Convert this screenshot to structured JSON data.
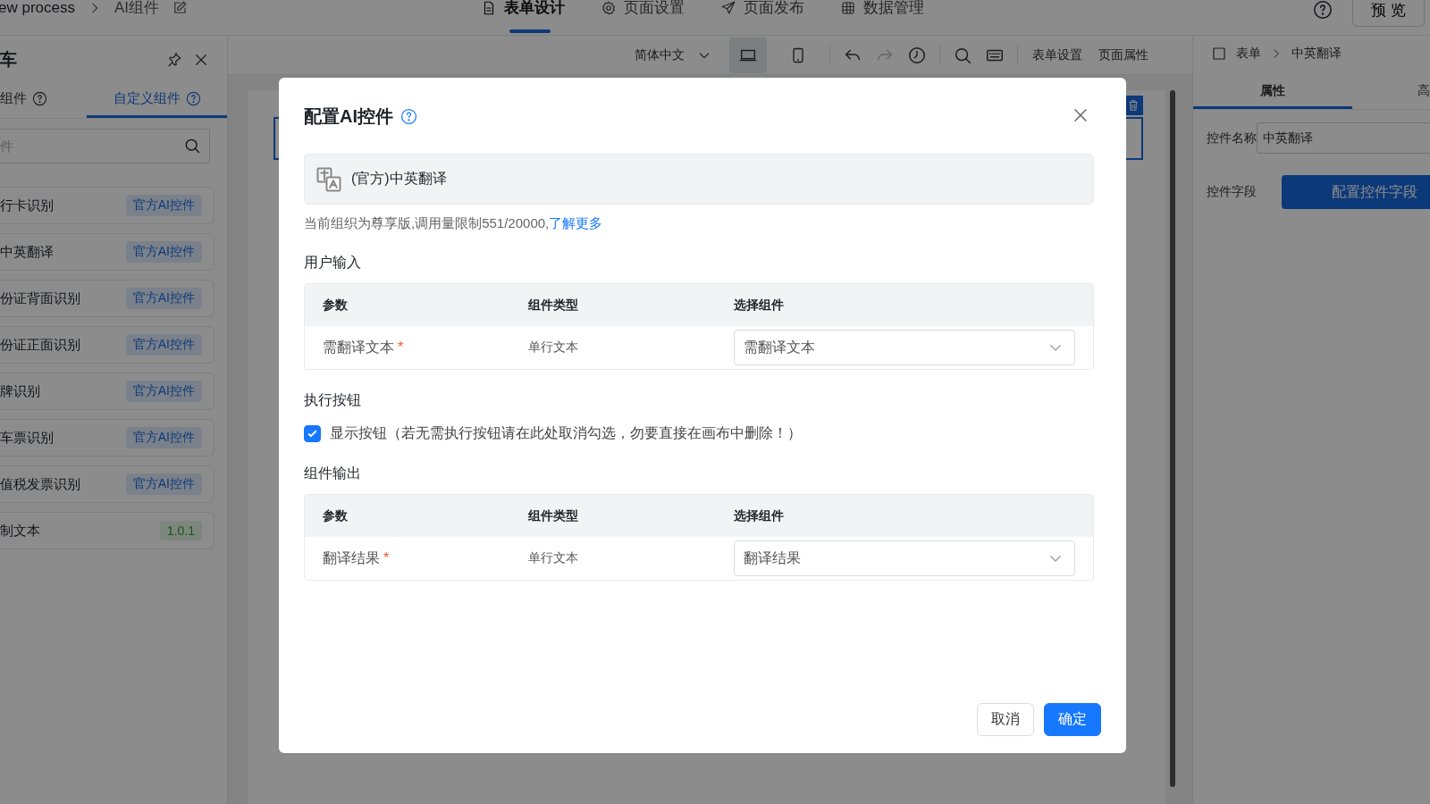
{
  "breadcrumb": [
    {
      "label": "ew process"
    },
    {
      "label": "AI组件"
    }
  ],
  "nav_tabs": [
    {
      "label": "表单设计",
      "selected": true
    },
    {
      "label": "页面设置",
      "selected": false
    },
    {
      "label": "页面发布",
      "selected": false
    },
    {
      "label": "数据管理",
      "selected": false
    }
  ],
  "preview_button": "预 览",
  "sidebar": {
    "title": "车",
    "tabs": [
      {
        "label": "组件",
        "selected": false
      },
      {
        "label": "自定义组件",
        "selected": true
      }
    ],
    "search": {
      "placeholder": "件"
    },
    "items": [
      {
        "name": "行卡识别",
        "tag": "官方AI控件",
        "kind": "official"
      },
      {
        "name": "中英翻译",
        "tag": "官方AI控件",
        "kind": "official"
      },
      {
        "name": "份证背面识别",
        "tag": "官方AI控件",
        "kind": "official"
      },
      {
        "name": "份证正面识别",
        "tag": "官方AI控件",
        "kind": "official"
      },
      {
        "name": "牌识别",
        "tag": "官方AI控件",
        "kind": "official"
      },
      {
        "name": "车票识别",
        "tag": "官方AI控件",
        "kind": "official"
      },
      {
        "name": "值税发票识别",
        "tag": "官方AI控件",
        "kind": "official"
      },
      {
        "name": "制文本",
        "tag": "1.0.1",
        "kind": "version"
      }
    ]
  },
  "toolbar": {
    "language": "简体中文",
    "devices": [
      {
        "kind": "laptop",
        "selected": true
      },
      {
        "kind": "phone",
        "selected": false
      }
    ],
    "actions": [
      "表单设置",
      "页面属性"
    ]
  },
  "right_panel": {
    "breadcrumb": [
      "表单",
      "中英翻译"
    ],
    "tabs": [
      {
        "label": "属性",
        "selected": true
      },
      {
        "label": "高",
        "selected": false
      }
    ],
    "fields": [
      {
        "label": "控件名称",
        "value": "中英翻译",
        "kind": "input"
      },
      {
        "label": "控件字段",
        "value": "配置控件字段",
        "kind": "button"
      }
    ]
  },
  "dialog": {
    "title": "配置AI控件",
    "component": "(官方)中英翻译",
    "quota_text": "当前组织为尊享版,调用量限制551/20000,",
    "learn_more": "了解更多",
    "input_section": {
      "title": "用户输入",
      "columns": [
        "参数",
        "组件类型",
        "选择组件"
      ],
      "rows": [
        {
          "param": "需翻译文本",
          "required_mark": "*",
          "type": "单行文本",
          "selection": "需翻译文本"
        }
      ]
    },
    "button_section": {
      "title": "执行按钮",
      "checkbox": {
        "label": "显示按钮（若无需执行按钮请在此处取消勾选，勿要直接在画布中删除！）",
        "checked": true
      }
    },
    "output_section": {
      "title": "组件输出",
      "columns": [
        "参数",
        "组件类型",
        "选择组件"
      ],
      "rows": [
        {
          "param": "翻译结果",
          "required_mark": "*",
          "type": "单行文本",
          "selection": "翻译结果"
        }
      ]
    },
    "buttons": [
      {
        "label": "取消",
        "kind": "default"
      },
      {
        "label": "确定",
        "kind": "primary"
      }
    ]
  }
}
